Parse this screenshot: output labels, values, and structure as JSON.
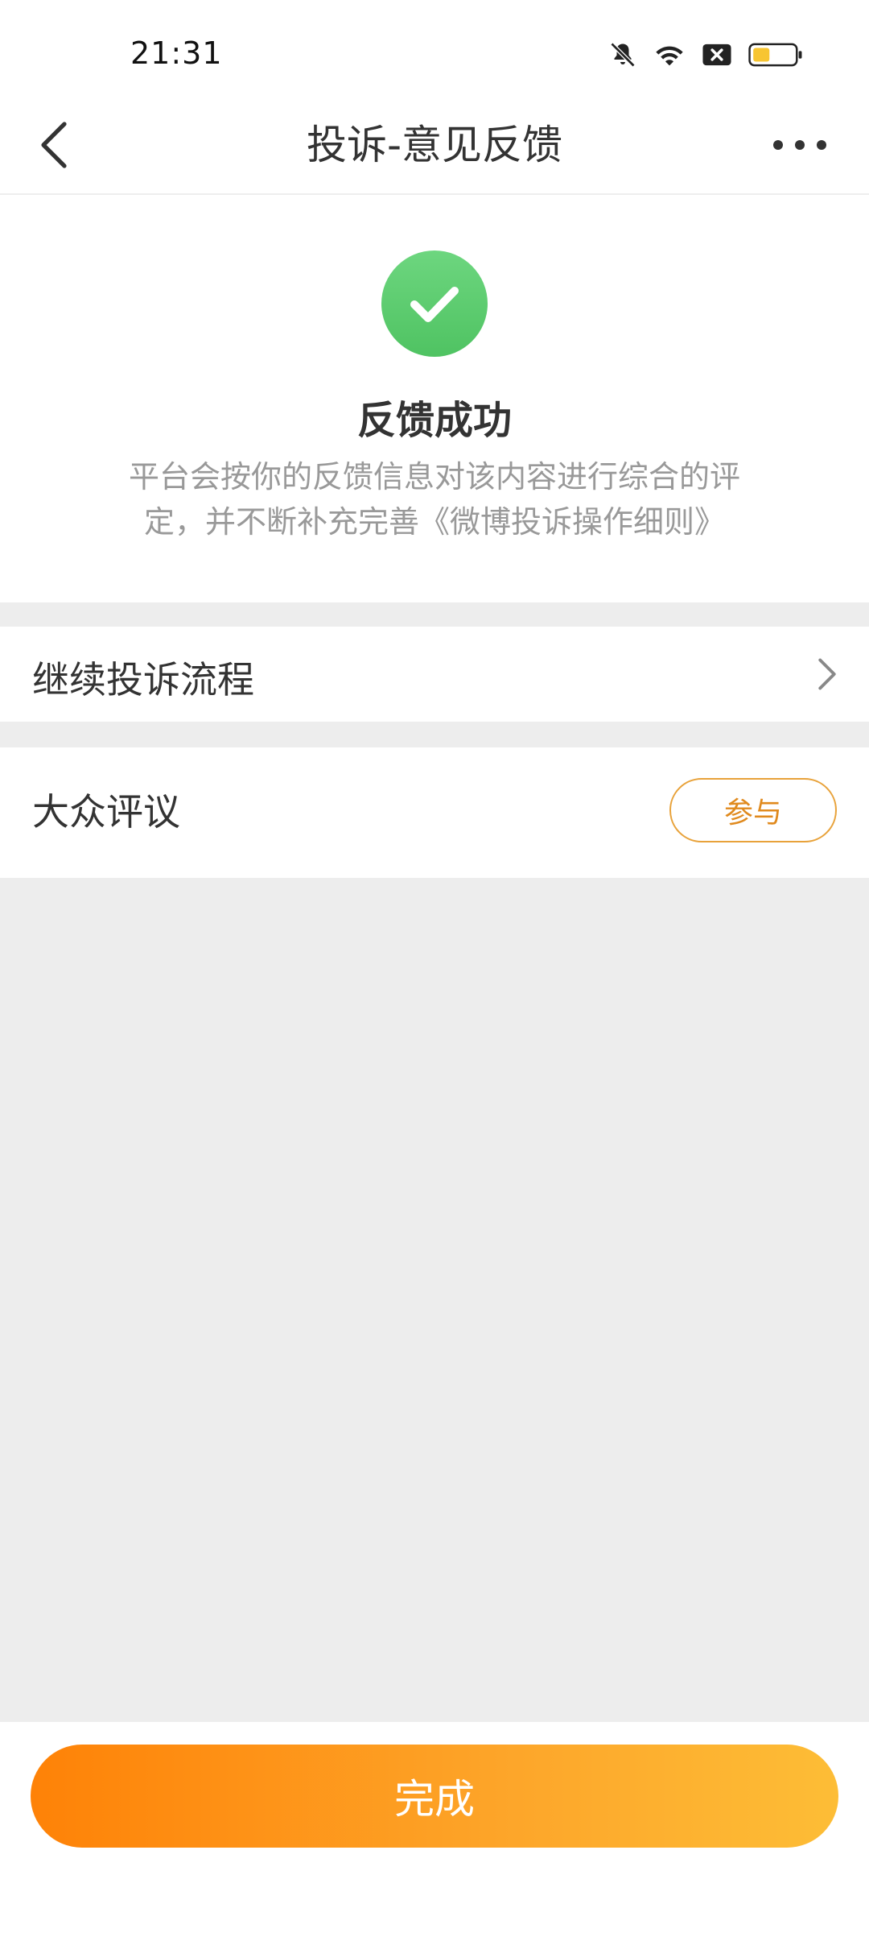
{
  "status_bar": {
    "time": "21:31",
    "icons": [
      "bell-off-icon",
      "wifi-icon",
      "sim-disabled-icon",
      "battery-icon"
    ],
    "battery_color": "#f7c531"
  },
  "nav": {
    "title": "投诉-意见反馈",
    "back_icon": "chevron-left-icon",
    "more_icon": "more-dots-icon"
  },
  "success": {
    "icon": "check-circle-icon",
    "icon_color": "#5ccb6e",
    "title": "反馈成功",
    "description_line1": "平台会按你的反馈信息对该内容进行综合的评",
    "description_line2": "定，并不断补充完善《微博投诉操作细则》"
  },
  "rows": {
    "continue_label": "继续投诉流程",
    "public_label": "大众评议",
    "participate_label": "参与"
  },
  "footer": {
    "done_label": "完成",
    "accent_start": "#fe8207",
    "accent_end": "#fdbd36"
  }
}
